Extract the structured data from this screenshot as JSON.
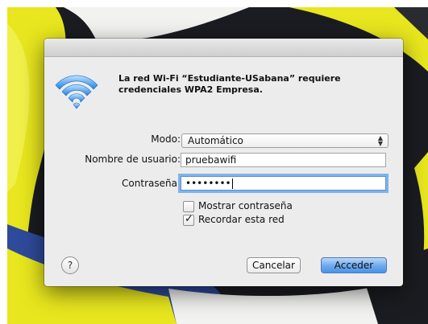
{
  "dialog": {
    "message": "La red Wi-Fi “Estudiante-USabana” requiere credenciales WPA2 Empresa.",
    "mode_label": "Modo:",
    "mode_value": "Automático",
    "username_label": "Nombre de usuario:",
    "username_value": "pruebawifi",
    "password_label": "Contraseña:",
    "password_value": "••••••••",
    "show_password_label": "Mostrar contraseña",
    "show_password_checked": false,
    "remember_label": "Recordar esta red",
    "remember_checked": true,
    "help_label": "?",
    "cancel_label": "Cancelar",
    "connect_label": "Acceder",
    "icon": "wifi-icon"
  },
  "colors": {
    "accent": "#4b92e6",
    "focus_ring": "#7fb3ea",
    "wallpaper_yellow": "#e8e61e",
    "wallpaper_blue": "#2e4a9a"
  }
}
